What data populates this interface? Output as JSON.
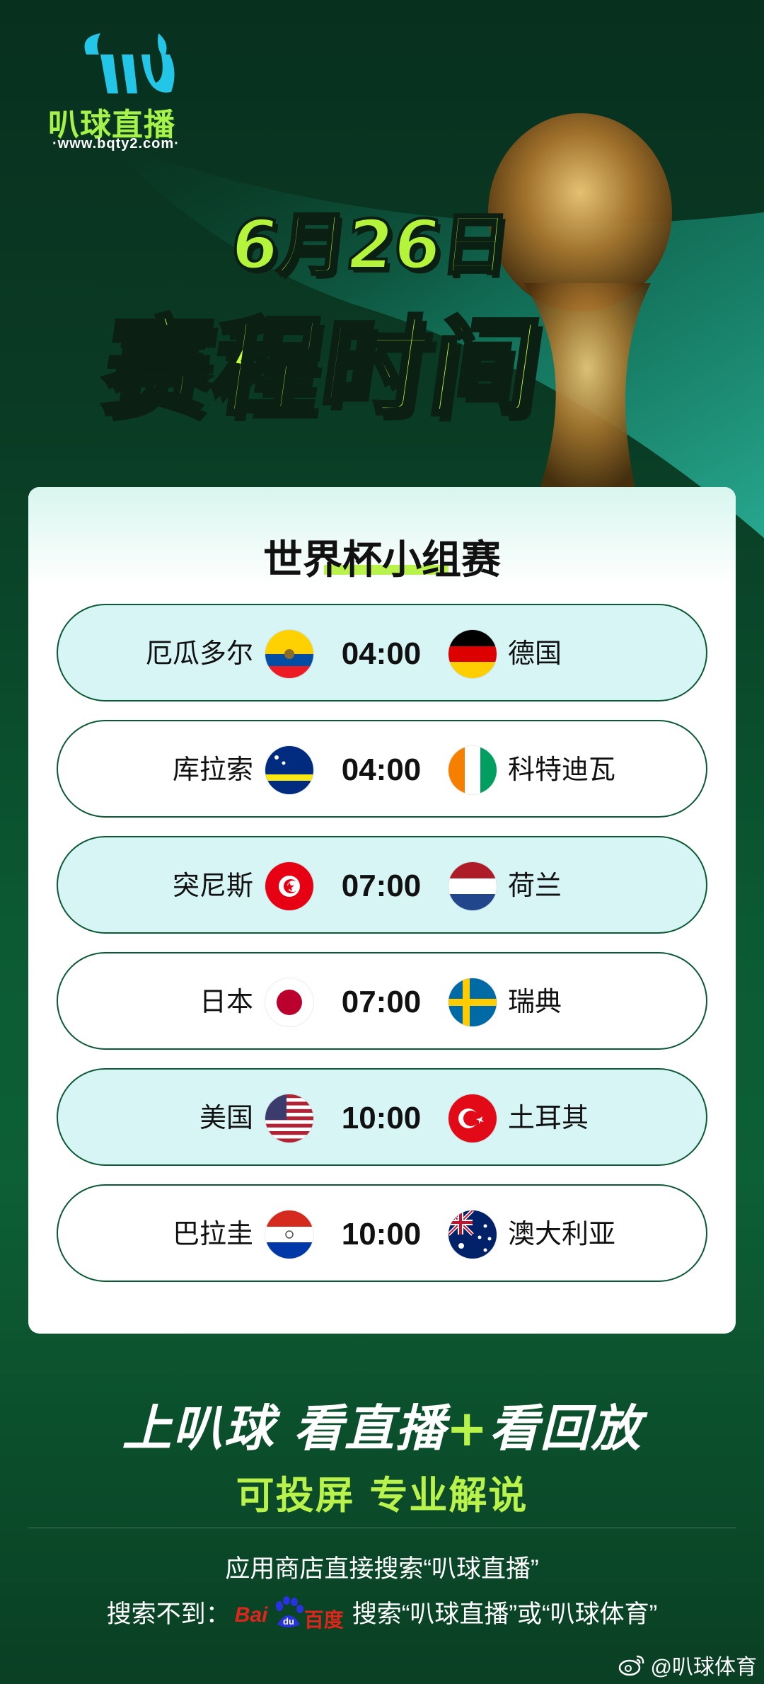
{
  "brand": {
    "logo_name": "叭球直播",
    "logo_url": "·www.bqty2.com·"
  },
  "title": {
    "date": "6月26日",
    "main": "赛程时间"
  },
  "card": {
    "title": "世界杯小组赛",
    "matches": [
      {
        "home": "厄瓜多尔",
        "time": "04:00",
        "away": "德国",
        "home_flag": "ecuador-flag-icon",
        "away_flag": "germany-flag-icon"
      },
      {
        "home": "库拉索",
        "time": "04:00",
        "away": "科特迪瓦",
        "home_flag": "curacao-flag-icon",
        "away_flag": "ivory-coast-flag-icon"
      },
      {
        "home": "突尼斯",
        "time": "07:00",
        "away": "荷兰",
        "home_flag": "tunisia-flag-icon",
        "away_flag": "netherlands-flag-icon"
      },
      {
        "home": "日本",
        "time": "07:00",
        "away": "瑞典",
        "home_flag": "japan-flag-icon",
        "away_flag": "sweden-flag-icon"
      },
      {
        "home": "美国",
        "time": "10:00",
        "away": "土耳其",
        "home_flag": "usa-flag-icon",
        "away_flag": "turkey-flag-icon"
      },
      {
        "home": "巴拉圭",
        "time": "10:00",
        "away": "澳大利亚",
        "home_flag": "paraguay-flag-icon",
        "away_flag": "australia-flag-icon"
      }
    ]
  },
  "promo": {
    "slogan_a": "上叭球 看直播",
    "slogan_plus": "+",
    "slogan_b": "看回放",
    "sub": "可投屏 专业解说",
    "hint1": "应用商店直接搜索“叭球直播”",
    "hint2_prefix": "搜索不到：",
    "baidu_bai": "Bai",
    "baidu_du": "du",
    "baidu_baike": "百度",
    "hint2_suffix": "搜索“叭球直播”或“叭球体育”"
  },
  "watermark": "@叭球体育",
  "colors": {
    "accent_green": "#b8f24a",
    "bg_dark_green": "#0a4a2b",
    "row_alt": "#d8f5f5"
  }
}
